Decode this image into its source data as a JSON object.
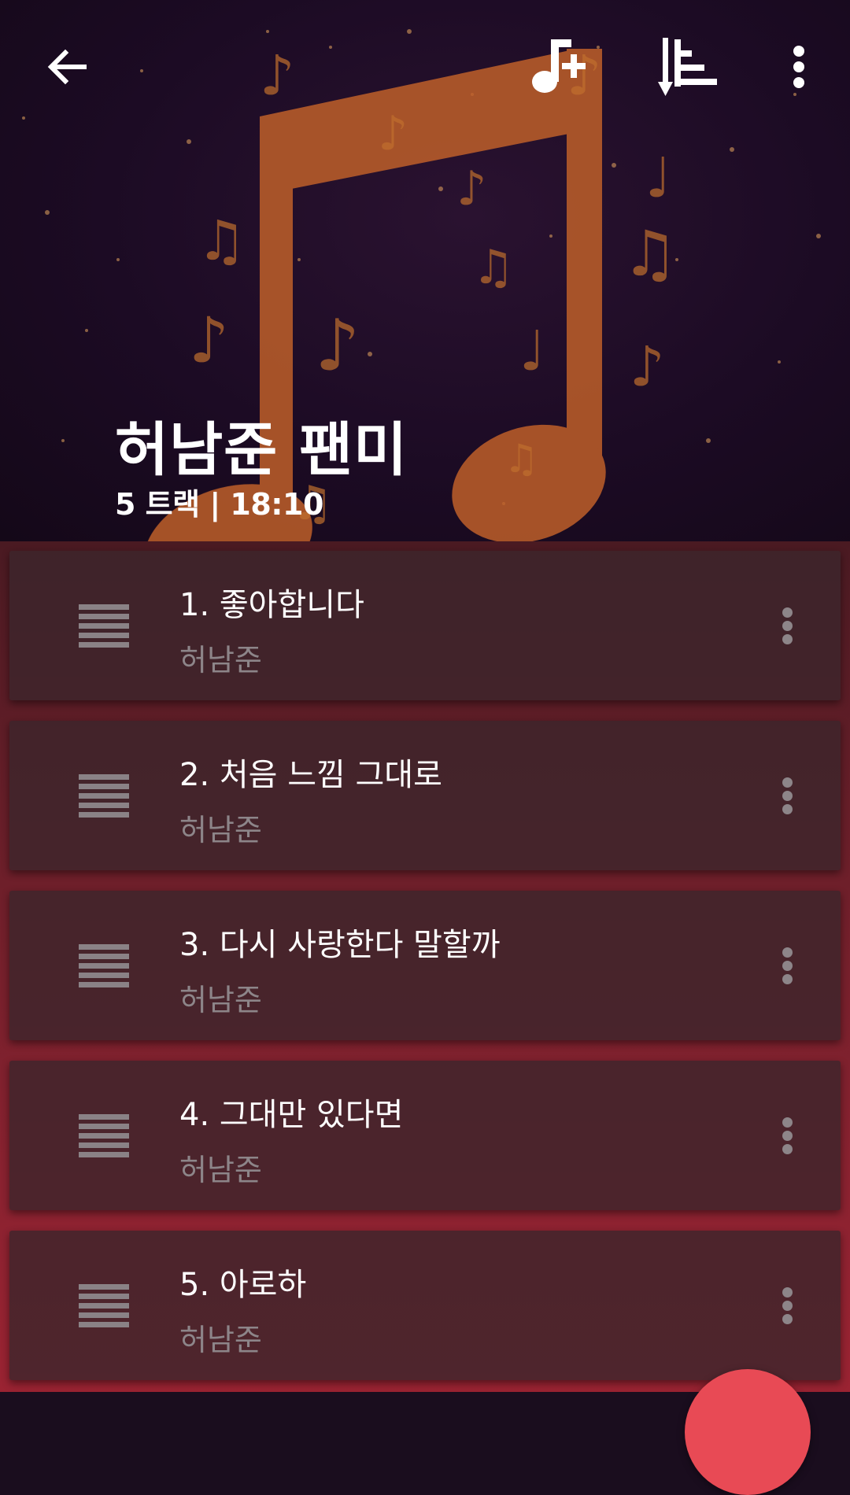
{
  "header": {
    "title": "허남준 팬미",
    "subtitle": "5 트랙 | 18:10",
    "icons": {
      "back": "arrow-left-icon",
      "add_track": "music-note-plus-icon",
      "sort": "sort-icon",
      "more": "more-vertical-icon"
    }
  },
  "tracks": [
    {
      "title": "1. 좋아합니다",
      "artist": "허남준"
    },
    {
      "title": "2. 처음 느낌 그대로",
      "artist": "허남준"
    },
    {
      "title": "3. 다시 사랑한다 말할까",
      "artist": "허남준"
    },
    {
      "title": "4. 그대만 있다면",
      "artist": "허남준"
    },
    {
      "title": "5. 아로하",
      "artist": "허남준"
    }
  ],
  "colors": {
    "accent": "#e84a55",
    "note_art": "#c0602a",
    "header_bg": "#1c0b24"
  }
}
